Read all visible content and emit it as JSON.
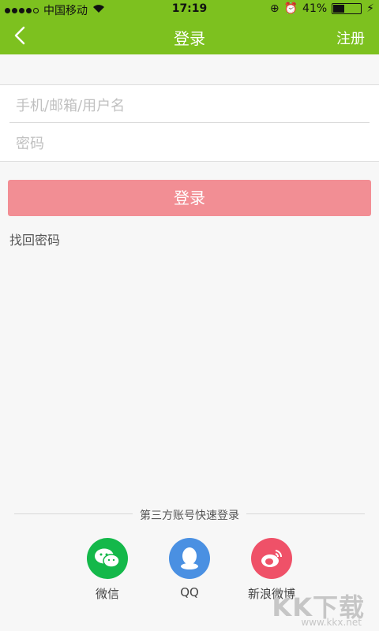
{
  "status_bar": {
    "carrier": "中国移动",
    "time": "17:19",
    "battery_text": "41%",
    "battery_level": 0.41
  },
  "nav": {
    "title": "登录",
    "right_button": "注册",
    "back_icon": "chevron-left-icon"
  },
  "form": {
    "username_placeholder": "手机/邮箱/用户名",
    "password_placeholder": "密码"
  },
  "login_button": "登录",
  "recover_password": "找回密码",
  "third_party": {
    "title": "第三方账号快速登录",
    "options": [
      {
        "label": "微信",
        "icon": "wechat-icon",
        "color": "#14b84a"
      },
      {
        "label": "QQ",
        "icon": "qq-icon",
        "color": "#4a90e2"
      },
      {
        "label": "新浪微博",
        "icon": "weibo-icon",
        "color": "#ef5168"
      }
    ]
  },
  "watermark": {
    "text": "KK下载",
    "url": "www.kkx.net"
  },
  "colors": {
    "primary": "#7dc11f",
    "login_button": "#f28e94"
  }
}
